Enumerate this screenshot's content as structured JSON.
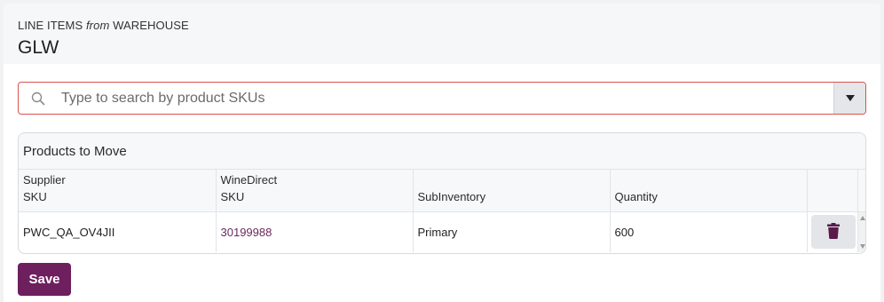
{
  "header": {
    "eyebrow_prefix": "LINE ITEMS",
    "eyebrow_from": "from",
    "eyebrow_suffix": "WAREHOUSE",
    "warehouse": "GLW"
  },
  "search": {
    "placeholder": "Type to search by product SKUs",
    "value": ""
  },
  "products": {
    "title": "Products to Move",
    "columns": [
      {
        "line1": "Supplier",
        "line2": "SKU"
      },
      {
        "line1": "WineDirect",
        "line2": "SKU"
      },
      {
        "line1": "",
        "line2": "SubInventory"
      },
      {
        "line1": "",
        "line2": "Quantity"
      }
    ],
    "rows": [
      {
        "supplier_sku": "PWC_QA_OV4JII",
        "winedirect_sku": "30199988",
        "subinventory": "Primary",
        "quantity": "600"
      }
    ]
  },
  "actions": {
    "save_label": "Save"
  },
  "colors": {
    "accent": "#6e1f5e",
    "link": "#6a2a5e",
    "error_border": "#d9534f"
  }
}
